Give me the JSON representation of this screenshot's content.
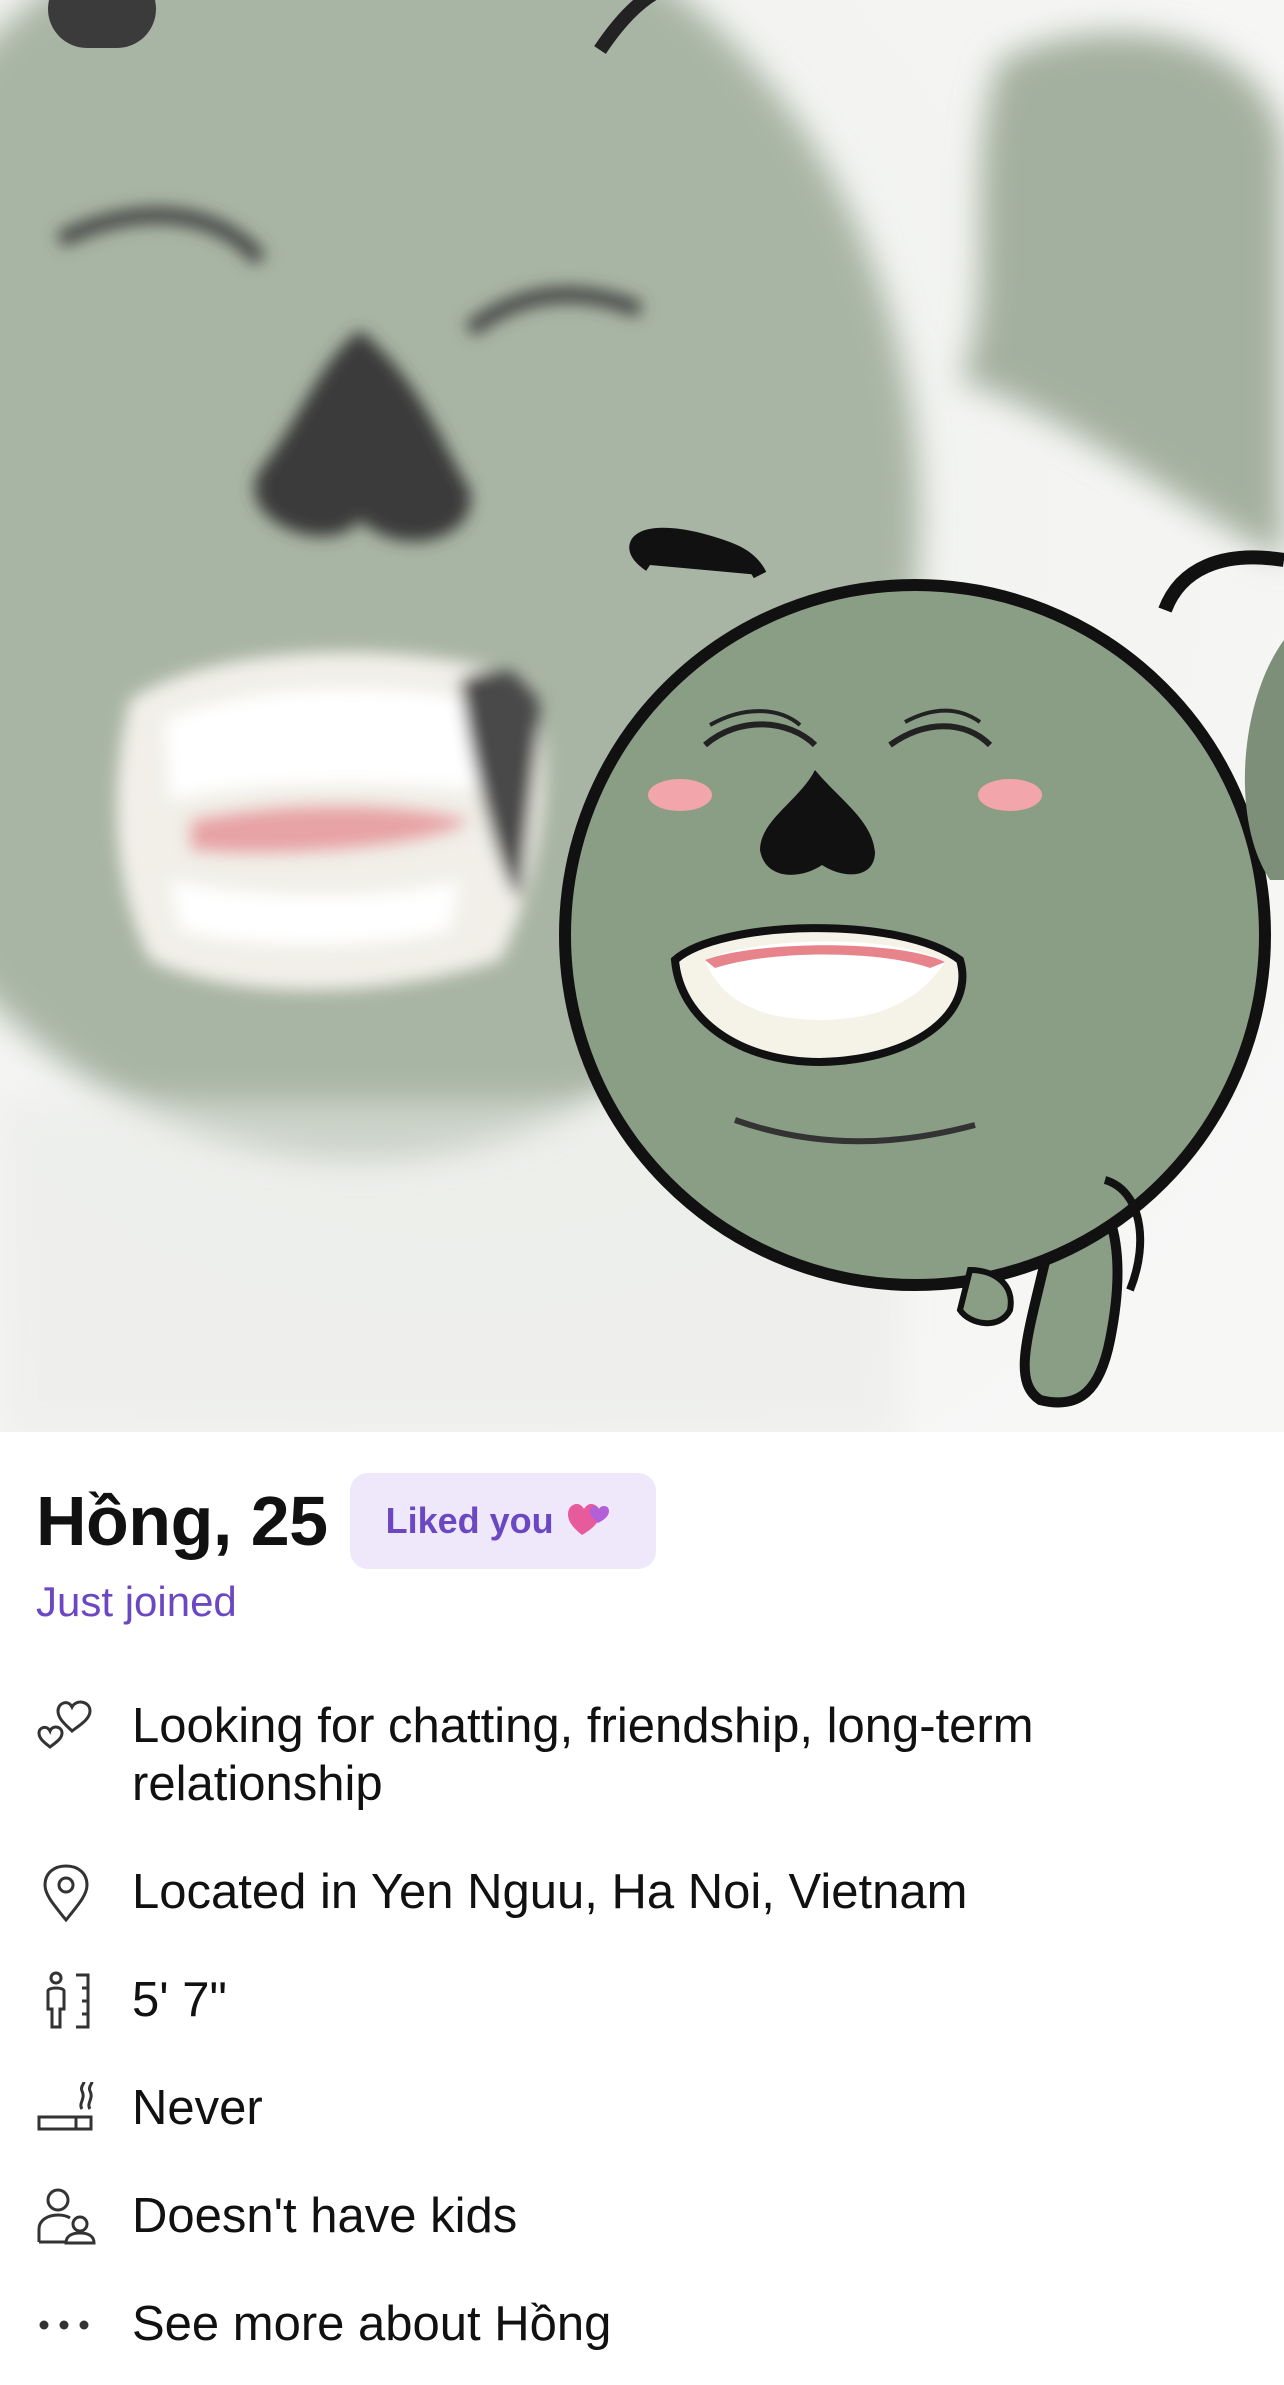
{
  "profile": {
    "name_age": "Hồng, 25",
    "liked_badge": "Liked you",
    "badge_emoji": "💞",
    "status": "Just joined"
  },
  "details": [
    {
      "icon": "hearts-icon",
      "text": "Looking for chatting, friendship, long-term relationship"
    },
    {
      "icon": "location-pin-icon",
      "text": "Located in Yen Nguu, Ha Noi, Vietnam"
    },
    {
      "icon": "height-icon",
      "text": "5' 7\""
    },
    {
      "icon": "cigarette-icon",
      "text": "Never"
    },
    {
      "icon": "kids-icon",
      "text": "Doesn't have kids"
    },
    {
      "icon": "more-dots-icon",
      "text": "See more about Hồng"
    }
  ],
  "colors": {
    "accent": "#6b48c2",
    "badge_bg": "#efe8fb",
    "character_green": "#8a9e86"
  }
}
